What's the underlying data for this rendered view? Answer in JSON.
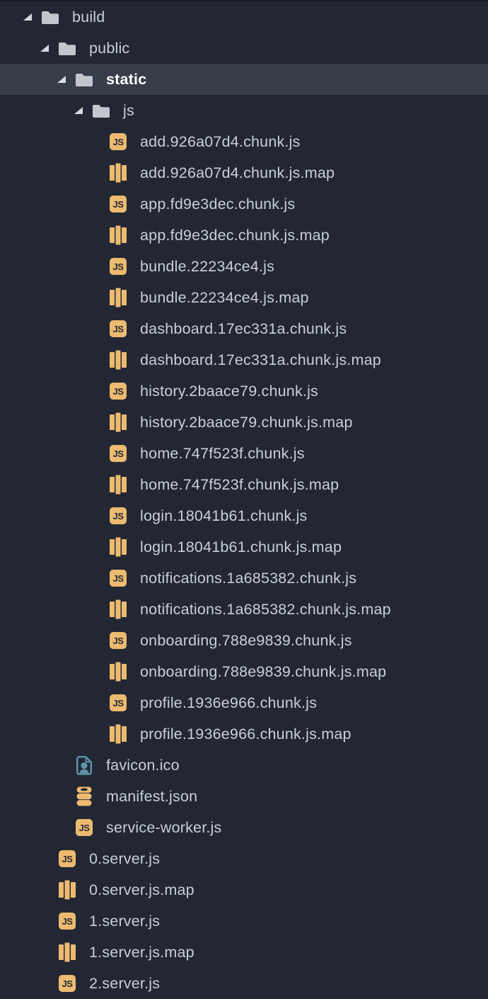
{
  "colors": {
    "background": "#222733",
    "selected_row_background": "#363D49",
    "text": "#C9CFD6",
    "selected_text": "#FFFFFF",
    "folder_icon": "#C3C7CD",
    "arrow_icon": "#D6D9DF",
    "js_icon_background": "#EDBA70",
    "js_icon_text": "#262B35",
    "map_icon": "#EDBA70",
    "database_icon": "#EDBA70",
    "image_icon": "#5E95AB"
  },
  "icons": {
    "js_badge_label": "JS"
  },
  "tree": {
    "rows": [
      {
        "label": "build",
        "kind": "folder",
        "level": 0,
        "expanded": true,
        "selected": false
      },
      {
        "label": "public",
        "kind": "folder",
        "level": 1,
        "expanded": true,
        "selected": false
      },
      {
        "label": "static",
        "kind": "folder",
        "level": 2,
        "expanded": true,
        "selected": true
      },
      {
        "label": "js",
        "kind": "folder",
        "level": 3,
        "expanded": true,
        "selected": false
      },
      {
        "label": "add.926a07d4.chunk.js",
        "kind": "js",
        "level": 4,
        "selected": false
      },
      {
        "label": "add.926a07d4.chunk.js.map",
        "kind": "map",
        "level": 4,
        "selected": false
      },
      {
        "label": "app.fd9e3dec.chunk.js",
        "kind": "js",
        "level": 4,
        "selected": false
      },
      {
        "label": "app.fd9e3dec.chunk.js.map",
        "kind": "map",
        "level": 4,
        "selected": false
      },
      {
        "label": "bundle.22234ce4.js",
        "kind": "js",
        "level": 4,
        "selected": false
      },
      {
        "label": "bundle.22234ce4.js.map",
        "kind": "map",
        "level": 4,
        "selected": false
      },
      {
        "label": "dashboard.17ec331a.chunk.js",
        "kind": "js",
        "level": 4,
        "selected": false
      },
      {
        "label": "dashboard.17ec331a.chunk.js.map",
        "kind": "map",
        "level": 4,
        "selected": false
      },
      {
        "label": "history.2baace79.chunk.js",
        "kind": "js",
        "level": 4,
        "selected": false
      },
      {
        "label": "history.2baace79.chunk.js.map",
        "kind": "map",
        "level": 4,
        "selected": false
      },
      {
        "label": "home.747f523f.chunk.js",
        "kind": "js",
        "level": 4,
        "selected": false
      },
      {
        "label": "home.747f523f.chunk.js.map",
        "kind": "map",
        "level": 4,
        "selected": false
      },
      {
        "label": "login.18041b61.chunk.js",
        "kind": "js",
        "level": 4,
        "selected": false
      },
      {
        "label": "login.18041b61.chunk.js.map",
        "kind": "map",
        "level": 4,
        "selected": false
      },
      {
        "label": "notifications.1a685382.chunk.js",
        "kind": "js",
        "level": 4,
        "selected": false
      },
      {
        "label": "notifications.1a685382.chunk.js.map",
        "kind": "map",
        "level": 4,
        "selected": false
      },
      {
        "label": "onboarding.788e9839.chunk.js",
        "kind": "js",
        "level": 4,
        "selected": false
      },
      {
        "label": "onboarding.788e9839.chunk.js.map",
        "kind": "map",
        "level": 4,
        "selected": false
      },
      {
        "label": "profile.1936e966.chunk.js",
        "kind": "js",
        "level": 4,
        "selected": false
      },
      {
        "label": "profile.1936e966.chunk.js.map",
        "kind": "map",
        "level": 4,
        "selected": false
      },
      {
        "label": "favicon.ico",
        "kind": "image",
        "level": 2,
        "selected": false
      },
      {
        "label": "manifest.json",
        "kind": "database",
        "level": 2,
        "selected": false
      },
      {
        "label": "service-worker.js",
        "kind": "js",
        "level": 2,
        "selected": false
      },
      {
        "label": "0.server.js",
        "kind": "js",
        "level": 1,
        "selected": false
      },
      {
        "label": "0.server.js.map",
        "kind": "map",
        "level": 1,
        "selected": false
      },
      {
        "label": "1.server.js",
        "kind": "js",
        "level": 1,
        "selected": false
      },
      {
        "label": "1.server.js.map",
        "kind": "map",
        "level": 1,
        "selected": false
      },
      {
        "label": "2.server.js",
        "kind": "js",
        "level": 1,
        "selected": false
      }
    ]
  }
}
